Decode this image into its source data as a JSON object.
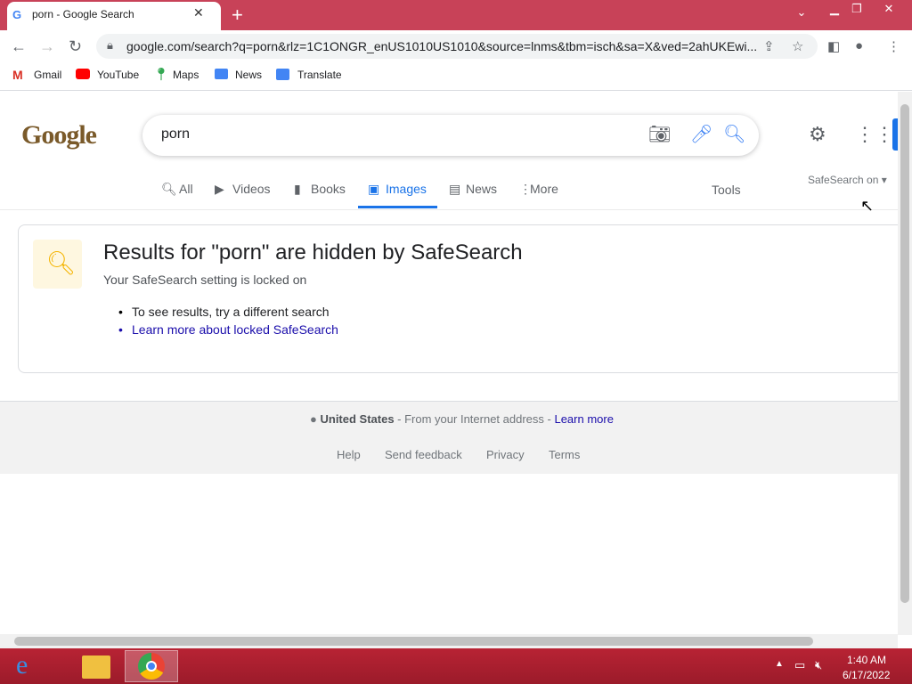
{
  "browser": {
    "tab_title": "porn - Google Search",
    "favicon": "G",
    "url": "google.com/search?q=porn&rlz=1C1ONGR_enUS1010US1010&source=lnms&tbm=isch&sa=X&ved=2ahUKEwi..."
  },
  "bookmarks": [
    {
      "label": "Gmail",
      "icon": "gmail-icon"
    },
    {
      "label": "YouTube",
      "icon": "youtube-icon"
    },
    {
      "label": "Maps",
      "icon": "maps-icon"
    },
    {
      "label": "News",
      "icon": "news-icon"
    },
    {
      "label": "Translate",
      "icon": "translate-icon"
    }
  ],
  "search": {
    "logo": "Google",
    "query": "porn"
  },
  "tabs": {
    "all": "All",
    "videos": "Videos",
    "books": "Books",
    "images": "Images",
    "news": "News",
    "more": "More",
    "tools": "Tools",
    "safesearch": "SafeSearch on"
  },
  "notice": {
    "heading": "Results for \"porn\" are hidden by SafeSearch",
    "subheading": "Your SafeSearch setting is locked on",
    "bullet1": "To see results, try a different search",
    "bullet2": "Learn more about locked SafeSearch"
  },
  "footer": {
    "location": "United States",
    "location_suffix": " - From your Internet address - ",
    "learn_more": "Learn more",
    "help": "Help",
    "feedback": "Send feedback",
    "privacy": "Privacy",
    "terms": "Terms"
  },
  "taskbar": {
    "time": "1:40 AM",
    "date": "6/17/2022"
  },
  "colors": {
    "accent": "#1a73e8",
    "titlebar": "#c84258",
    "taskbar": "#b82334"
  }
}
